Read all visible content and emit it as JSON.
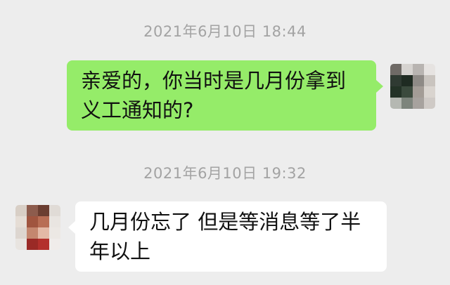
{
  "conversation": {
    "messages": [
      {
        "timestamp": "2021年6月10日 18:44",
        "direction": "outgoing",
        "text": "亲爱的，你当时是几月份拿到义工通知的?",
        "bubble_color": "#95ec69"
      },
      {
        "timestamp": "2021年6月10日 19:32",
        "direction": "incoming",
        "text": "几月份忘了 但是等消息等了半年以上",
        "bubble_color": "#ffffff"
      }
    ]
  },
  "colors": {
    "background": "#ededed",
    "timestamp_text": "#a3a3a3",
    "message_text": "#111111"
  }
}
